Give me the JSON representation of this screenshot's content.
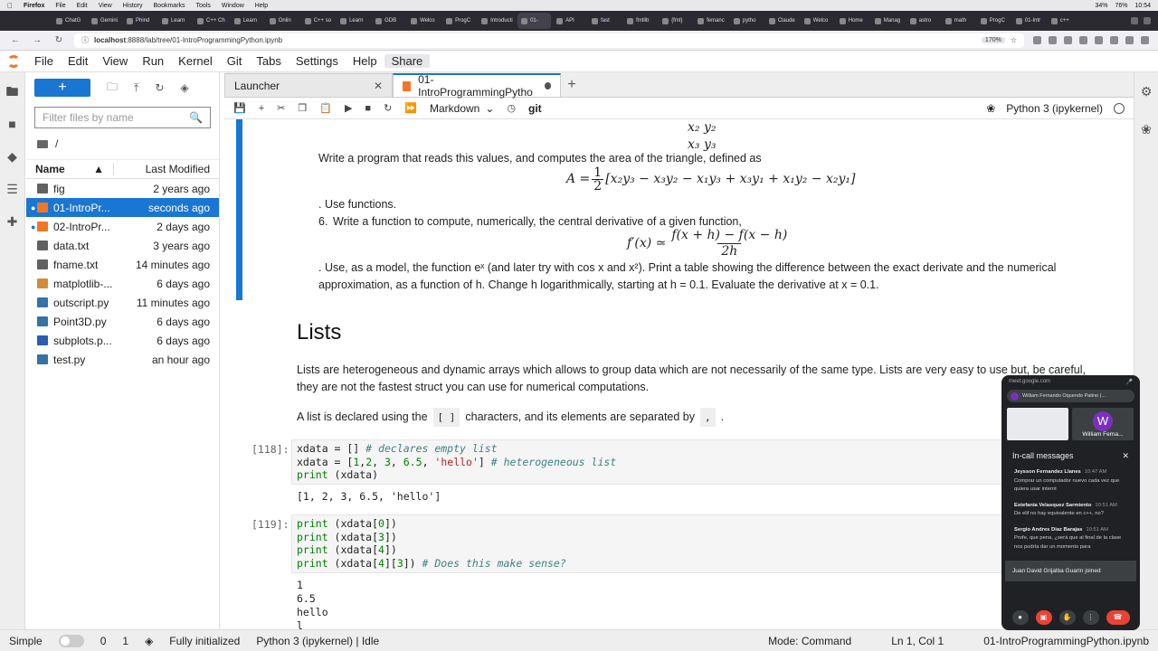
{
  "mac_menu": {
    "app": "Firefox",
    "items": [
      "File",
      "Edit",
      "View",
      "History",
      "Bookmarks",
      "Tools",
      "Window",
      "Help"
    ],
    "right": [
      "34%",
      "76%",
      "10:54"
    ]
  },
  "browser_tabs": [
    "ChatG",
    "Gemini",
    "Phind",
    "Learn",
    "C++ Ch",
    "Learn",
    "Onlin",
    "C++ so",
    "Learn",
    "GDB",
    "Welco",
    "ProgC",
    "Introducti",
    "01-",
    "API",
    "fast",
    "fmtlib",
    "{fmt}",
    "femanc",
    "pytho",
    "Claude",
    "Welco",
    "Home",
    "Manag",
    "astro",
    "math",
    "ProgC",
    "01-Intr",
    "c++"
  ],
  "url": {
    "host": "localhost",
    "path": ":8888/lab/tree/01-IntroProgrammingPython.ipynb",
    "zoom": "170%"
  },
  "jupyter_menu": [
    "File",
    "Edit",
    "View",
    "Run",
    "Kernel",
    "Git",
    "Tabs",
    "Settings",
    "Help",
    "Share"
  ],
  "filebrowser": {
    "filter_placeholder": "Filter files by name",
    "breadcrumb": "/",
    "col_name": "Name",
    "col_modified": "Last Modified",
    "files": [
      {
        "name": "fig",
        "modified": "2 years ago",
        "type": "folder",
        "icon_color": "#616161"
      },
      {
        "name": "01-IntroPr...",
        "modified": "seconds ago",
        "type": "notebook",
        "icon_color": "#f37626",
        "selected": true,
        "running": true
      },
      {
        "name": "02-IntroPr...",
        "modified": "2 days ago",
        "type": "notebook",
        "icon_color": "#f37626",
        "running": true
      },
      {
        "name": "data.txt",
        "modified": "3 years ago",
        "type": "text",
        "icon_color": "#616161"
      },
      {
        "name": "fname.txt",
        "modified": "14 minutes ago",
        "type": "text",
        "icon_color": "#616161"
      },
      {
        "name": "matplotlib-...",
        "modified": "6 days ago",
        "type": "folder",
        "icon_color": "#d08c3b"
      },
      {
        "name": "outscript.py",
        "modified": "11 minutes ago",
        "type": "python",
        "icon_color": "#3572a5"
      },
      {
        "name": "Point3D.py",
        "modified": "6 days ago",
        "type": "python",
        "icon_color": "#3572a5"
      },
      {
        "name": "subplots.p...",
        "modified": "6 days ago",
        "type": "image",
        "icon_color": "#2a5db0"
      },
      {
        "name": "test.py",
        "modified": "an hour ago",
        "type": "python",
        "icon_color": "#3572a5"
      }
    ]
  },
  "doc_tabs": [
    {
      "label": "Launcher",
      "active": false
    },
    {
      "label": "01-IntroProgrammingPytho",
      "active": true
    }
  ],
  "nb_toolbar": {
    "cell_type": "Markdown",
    "git": "git",
    "kernel": "Python 3 (ipykernel)"
  },
  "notebook": {
    "md1_line_x2": "x₂   y₂",
    "md1_line_x3": "x₃   y₃",
    "md1_text": "Write a program that reads this values, and computes the area of the triangle, defined as",
    "md1_formula_lhs": "A = ",
    "md1_formula_frac_num": "1",
    "md1_formula_frac_den": "2",
    "md1_formula_rhs": "[x₂y₃ − x₃y₂ − x₁y₃ + x₃y₁ + x₁y₂ − x₂y₁]",
    "md1_use": ". Use functions.",
    "item6_num": "6.",
    "item6_text": "Write a function to compute, numerically, the central derivative of a given function,",
    "item6_lhs": "f′(x) ≃",
    "item6_num_expr": "f(x + h) − f(x − h)",
    "item6_den_expr": "2h",
    "item6_desc1": ". Use, as a model, the function eˣ (and later try with cos x and x²). Print a table showing the difference between the exact derivate and the numerical",
    "item6_desc2": "approximation, as a function of h. Change h logarithmically, starting at h = 0.1. Evaluate the derivative at x = 0.1.",
    "lists_title": "Lists",
    "lists_p1a": "Lists are heterogeneous and dynamic arrays which allows to group data which are not necessarily of the same type. Lists are very easy to use but, be careful,",
    "lists_p1b": "they are not the fastest struct you can use for numerical computations.",
    "lists_p2a": "A list is declared using the",
    "lists_p2_chip1": "[ ]",
    "lists_p2b": "characters, and its elements are separated by",
    "lists_p2_chip2": ",",
    "lists_p2c": ".",
    "cell118_prompt": "[118]:",
    "cell118_output": "[1, 2, 3, 6.5, 'hello']",
    "cell119_prompt": "[119]:",
    "cell119_output": "1\n6.5\nhello\nl"
  },
  "statusbar": {
    "mode_label": "Simple",
    "terminals": "0",
    "kernels": "1",
    "init": "Fully initialized",
    "kernel_state": "Python 3 (ipykernel) | Idle",
    "mode": "Mode: Command",
    "cursor": "Ln 1, Col 1",
    "file": "01-IntroProgrammingPython.ipynb"
  },
  "meet": {
    "domain": "meet.google.com",
    "presenter": "William Fernando Oquendo Patino (...",
    "tile_name": "William Ferna...",
    "tile_initial": "W",
    "title": "In-call messages",
    "messages": [
      {
        "sender": "Jeysson Fernandez Llanes",
        "time": "10:47 AM",
        "text": "Comprar un computador nuevo cada vez que quiera usar internt"
      },
      {
        "sender": "Estefania Velasquez Sarmiento",
        "time": "10:51 AM",
        "text": "De elif no hay equivalente en c++, no?"
      },
      {
        "sender": "Sergio Andres Diaz Barajas",
        "time": "10:51 AM",
        "text": "Profe, que pena, ¿será que al final de la clase nos podría dar un momento para"
      }
    ],
    "joined": "Juan David Grijalba Guarín joined"
  },
  "colors": {
    "accent": "#1976d2",
    "jupyter_orange": "#f37626",
    "meet_bg": "#202124"
  }
}
